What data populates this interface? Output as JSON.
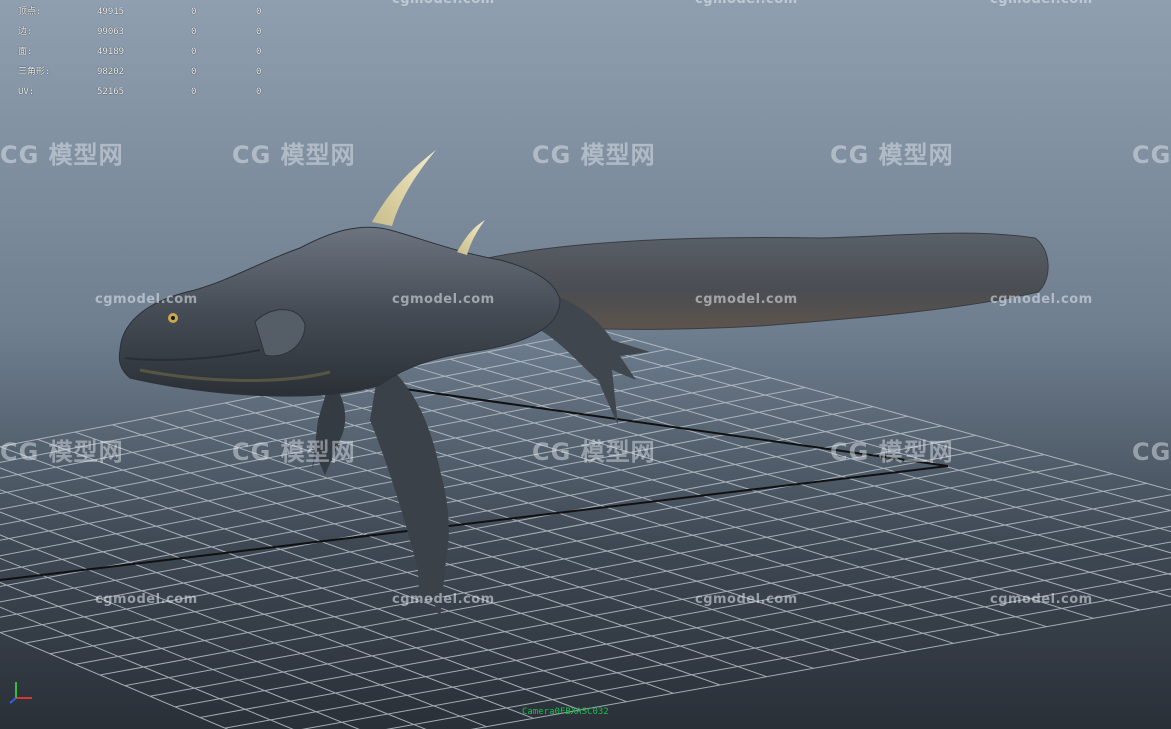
{
  "viewport": {
    "name": "Maya perspective viewport"
  },
  "poly_count": [
    {
      "label": "顶点:",
      "v1": "49915",
      "v2": "0",
      "v3": "0"
    },
    {
      "label": "边:",
      "v1": "99063",
      "v2": "0",
      "v3": "0"
    },
    {
      "label": "面:",
      "v1": "49189",
      "v2": "0",
      "v3": "0"
    },
    {
      "label": "三角形:",
      "v1": "98202",
      "v2": "0",
      "v3": "0"
    },
    {
      "label": "UV:",
      "v1": "52165",
      "v2": "0",
      "v3": "0"
    }
  ],
  "watermarks": {
    "url": "cgmodel.com",
    "logo": "CG 模型网"
  },
  "camera_label": "Camera0FBXASC032",
  "colors": {
    "bg_top": "#8f9fb0",
    "bg_bottom": "#2a3038",
    "grid_line": "#b8c0c8",
    "grid_axis": "#111111",
    "creature_body": "#4a5058",
    "horn": "#e0d6a6",
    "camera_label": "#19c04a"
  },
  "icons": [
    "axis-gizmo-icon"
  ]
}
